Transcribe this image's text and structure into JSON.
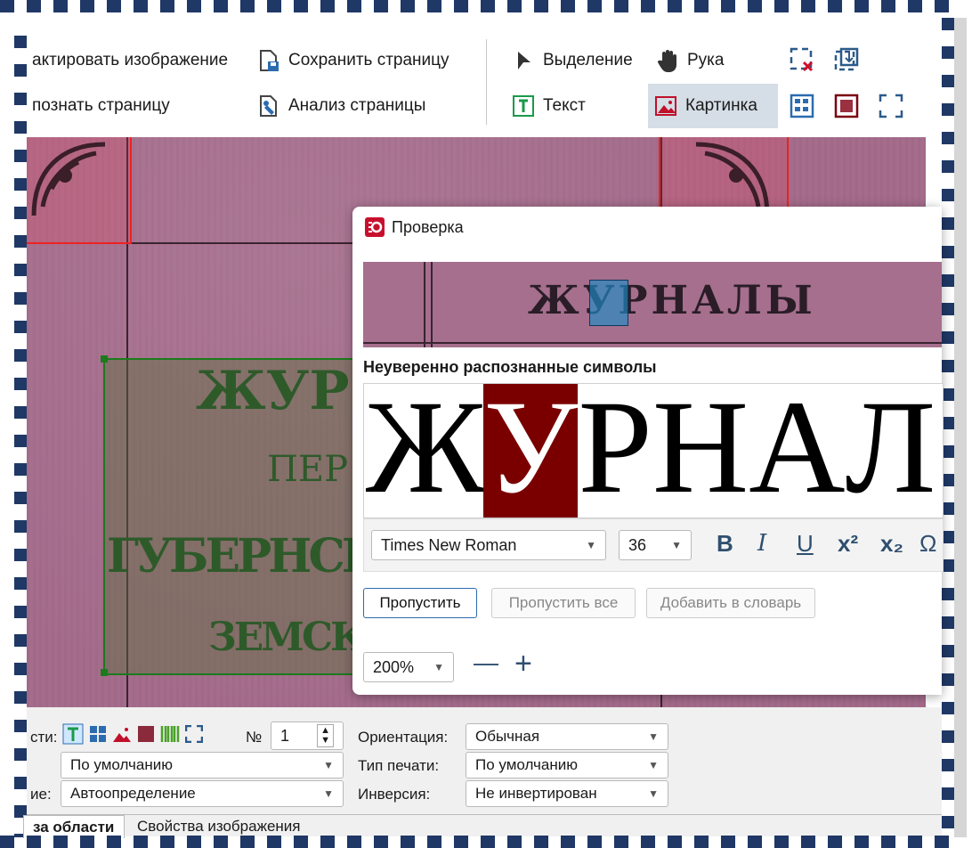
{
  "toolbar": {
    "edit_image": "актировать изображение",
    "recognize_page": "познать страницу",
    "save_page": "Сохранить страницу",
    "analyze_page": "Анализ страницы",
    "selection": "Выделение",
    "hand": "Рука",
    "text": "Текст",
    "picture": "Картинка"
  },
  "dialog": {
    "title": "Проверка",
    "preview_word": "ЖУРНАЛЫ",
    "section_label": "Неуверенно распознанные символы",
    "big_text_before": "Ж",
    "big_text_selected": "У",
    "big_text_after": "РНАЛ",
    "font_name": "Times New Roman",
    "font_size": "36",
    "format_bold": "B",
    "format_italic": "I",
    "format_underline": "U",
    "format_superscript": "x²",
    "format_subscript": "x₂",
    "format_symbol": "Ω",
    "skip_button": "Пропустить",
    "skip_all_button": "Пропустить все",
    "add_dict_button": "Добавить в словарь",
    "zoom_value": "200%",
    "zoom_out": "—",
    "zoom_in": "+"
  },
  "scan": {
    "line1": "ЖУР",
    "line2": "ПЕР",
    "line3": "ГУБЕРНСКАГО",
    "line4": "ЗЕМСКАГ"
  },
  "bottom": {
    "area_type_label": "сти:",
    "number_label": "№",
    "number_value": "1",
    "orientation_label": "Ориентация:",
    "orientation_value": "Обычная",
    "row2_left_value": "По умолчанию",
    "print_type_label": "Тип печати:",
    "print_type_value": "По умолчанию",
    "row3_left_label": "ие:",
    "row3_left_value": "Автоопределение",
    "inversion_label": "Инверсия:",
    "inversion_value": "Не инвертирован",
    "tab_area": "за области",
    "tab_image": "Свойства изображения"
  },
  "colors": {
    "accent_dark_red": "#7a0000",
    "frame_dash": "#1f3866",
    "canvas_pink": "#a56c8c",
    "green_area": "#1c7a1c"
  }
}
